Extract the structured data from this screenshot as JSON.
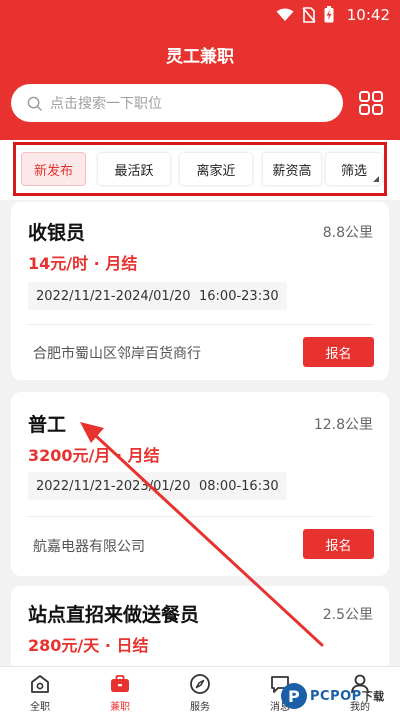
{
  "status_bar": {
    "time": "10:42",
    "icons": [
      "wifi-icon",
      "no-sim-icon",
      "battery-charging-icon"
    ]
  },
  "header": {
    "title": "灵工兼职"
  },
  "search": {
    "placeholder": "点击搜索一下职位"
  },
  "filters": [
    {
      "label": "新发布",
      "active": true
    },
    {
      "label": "最活跃",
      "active": false
    },
    {
      "label": "离家近",
      "active": false
    },
    {
      "label": "薪资高",
      "active": false
    },
    {
      "label": "筛选",
      "active": false
    }
  ],
  "jobs": [
    {
      "title": "收银员",
      "distance": "8.8公里",
      "pay": "14元/时 · 月结",
      "date_range": "2022/11/21-2024/01/20",
      "hours": "16:00-23:30",
      "company": "合肥市蜀山区邻岸百货商行",
      "apply_label": "报名"
    },
    {
      "title": "普工",
      "distance": "12.8公里",
      "pay": "3200元/月 · 月结",
      "date_range": "2022/11/21-2023/01/20",
      "hours": "08:00-16:30",
      "company": "航嘉电器有限公司",
      "apply_label": "报名"
    },
    {
      "title": "站点直招来做送餐员",
      "distance": "2.5公里",
      "pay": "280元/天 · 日结"
    }
  ],
  "bottom_nav": [
    {
      "label": "全职",
      "icon": "home-icon",
      "active": false
    },
    {
      "label": "兼职",
      "icon": "briefcase-icon",
      "active": true
    },
    {
      "label": "服务",
      "icon": "compass-icon",
      "active": false
    },
    {
      "label": "消息",
      "icon": "message-icon",
      "active": false
    },
    {
      "label": "我的",
      "icon": "user-icon",
      "active": false
    }
  ],
  "watermark": {
    "brand": "PCPOP",
    "suffix": "下载"
  },
  "colors": {
    "brand_red": "#e8322f",
    "highlight_red": "#d8191c",
    "background": "#f2f2f2"
  }
}
